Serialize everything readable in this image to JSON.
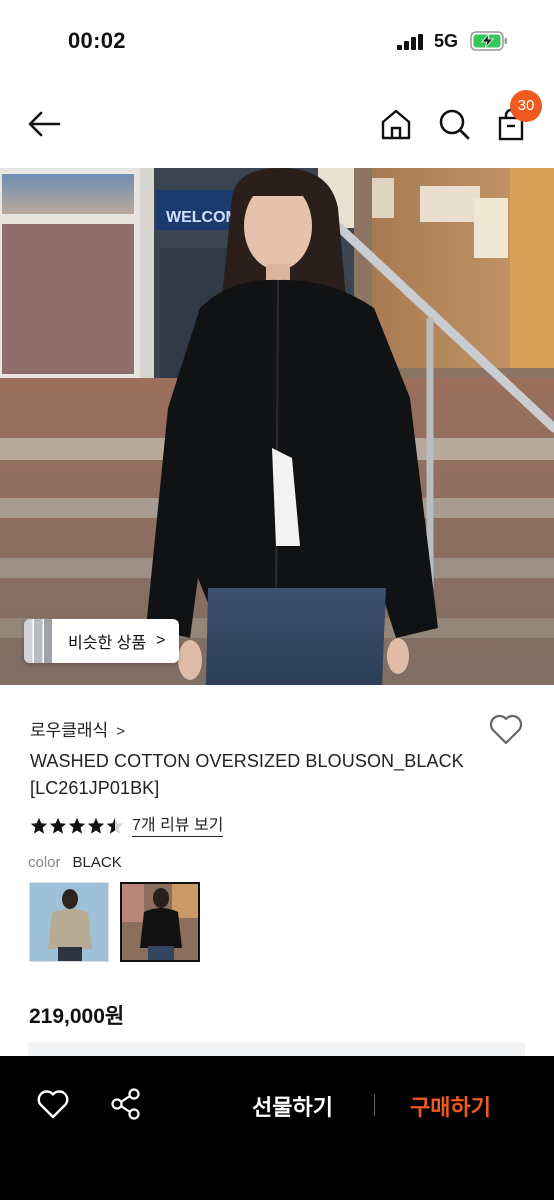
{
  "status_bar": {
    "time": "00:02",
    "network": "5G"
  },
  "nav": {
    "cart_count": "30"
  },
  "hero": {
    "similar_label": "비슷한 상품",
    "similar_chevron": ">"
  },
  "product": {
    "brand": "로우클래식",
    "brand_chevron": ">",
    "title": "WASHED COTTON OVERSIZED BLOUSON_BLACK [LC261JP01BK]",
    "rating": 4.5,
    "review_link": "7개 리뷰 보기",
    "color_key": "color",
    "color_value": "BLACK",
    "price": "219,000원"
  },
  "bottom_bar": {
    "gift_label": "선물하기",
    "buy_label": "구매하기"
  },
  "colors": {
    "accent": "#f05a1e",
    "bottom_bar_bg": "#000000"
  }
}
